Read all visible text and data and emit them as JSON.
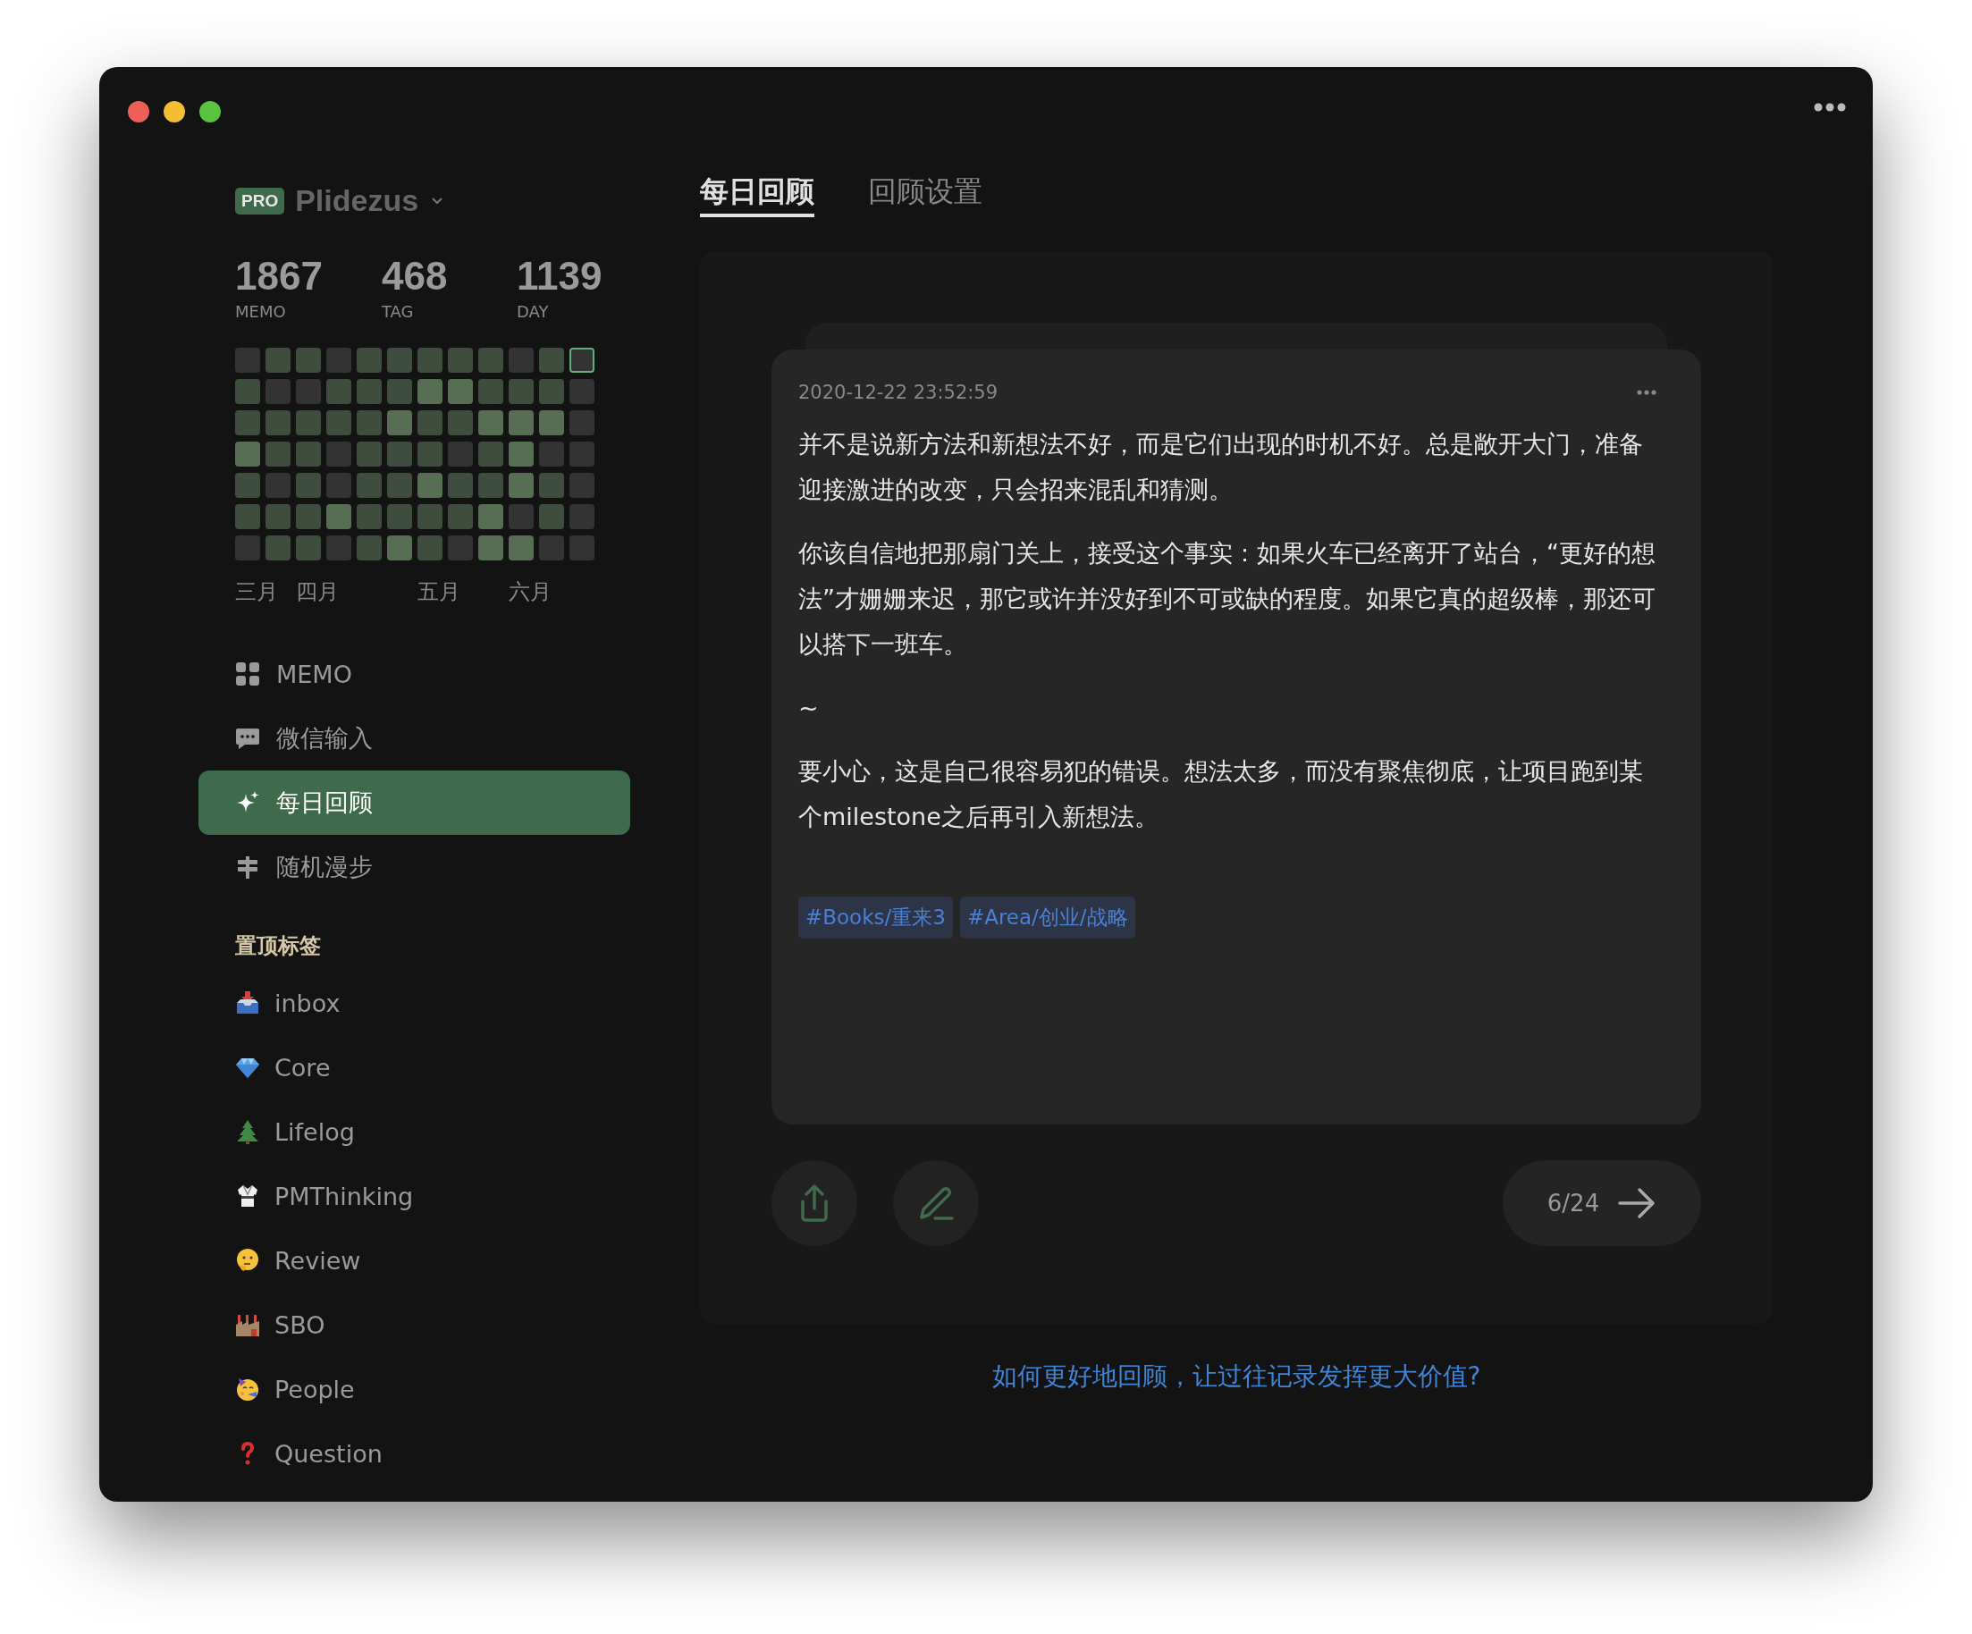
{
  "account": {
    "badge": "PRO",
    "name": "Plidezus"
  },
  "stats": [
    {
      "value": "1867",
      "label": "MEMO"
    },
    {
      "value": "468",
      "label": "TAG"
    },
    {
      "value": "1139",
      "label": "DAY"
    }
  ],
  "heatmap": {
    "rows": [
      {
        "cells": [
          {
            "color": "#333333",
            "selected": false
          },
          {
            "color": "#3f4d3f",
            "selected": false
          },
          {
            "color": "#3f4d3f",
            "selected": false
          },
          {
            "color": "#333333",
            "selected": false
          },
          {
            "color": "#3f4d3f",
            "selected": false
          },
          {
            "color": "#3f4d3f",
            "selected": false
          },
          {
            "color": "#3f4d3f",
            "selected": false
          },
          {
            "color": "#3f4d3f",
            "selected": false
          },
          {
            "color": "#3f4d3f",
            "selected": false
          },
          {
            "color": "#333333",
            "selected": false
          },
          {
            "color": "#3f4d3f",
            "selected": false
          },
          {
            "color": "#333333",
            "selected": true
          }
        ]
      },
      {
        "cells": [
          {
            "color": "#3f4d3f",
            "selected": false
          },
          {
            "color": "#333333",
            "selected": false
          },
          {
            "color": "#333333",
            "selected": false
          },
          {
            "color": "#3f4d3f",
            "selected": false
          },
          {
            "color": "#3f4d3f",
            "selected": false
          },
          {
            "color": "#3f4d3f",
            "selected": false
          },
          {
            "color": "#576e55",
            "selected": false
          },
          {
            "color": "#576e55",
            "selected": false
          },
          {
            "color": "#3f4d3f",
            "selected": false
          },
          {
            "color": "#3f4d3f",
            "selected": false
          },
          {
            "color": "#3f4d3f",
            "selected": false
          },
          {
            "color": "#333333",
            "selected": false
          }
        ]
      },
      {
        "cells": [
          {
            "color": "#3f4d3f",
            "selected": false
          },
          {
            "color": "#3f4d3f",
            "selected": false
          },
          {
            "color": "#3f4d3f",
            "selected": false
          },
          {
            "color": "#3f4d3f",
            "selected": false
          },
          {
            "color": "#3f4d3f",
            "selected": false
          },
          {
            "color": "#576e55",
            "selected": false
          },
          {
            "color": "#3f4d3f",
            "selected": false
          },
          {
            "color": "#3f4d3f",
            "selected": false
          },
          {
            "color": "#576e55",
            "selected": false
          },
          {
            "color": "#576e55",
            "selected": false
          },
          {
            "color": "#576e55",
            "selected": false
          },
          {
            "color": "#333333",
            "selected": false
          }
        ]
      },
      {
        "cells": [
          {
            "color": "#576e55",
            "selected": false
          },
          {
            "color": "#3f4d3f",
            "selected": false
          },
          {
            "color": "#3f4d3f",
            "selected": false
          },
          {
            "color": "#333333",
            "selected": false
          },
          {
            "color": "#3f4d3f",
            "selected": false
          },
          {
            "color": "#3f4d3f",
            "selected": false
          },
          {
            "color": "#3f4d3f",
            "selected": false
          },
          {
            "color": "#333333",
            "selected": false
          },
          {
            "color": "#3f4d3f",
            "selected": false
          },
          {
            "color": "#576e55",
            "selected": false
          },
          {
            "color": "#333333",
            "selected": false
          },
          {
            "color": "#333333",
            "selected": false
          }
        ]
      },
      {
        "cells": [
          {
            "color": "#3f4d3f",
            "selected": false
          },
          {
            "color": "#333333",
            "selected": false
          },
          {
            "color": "#3f4d3f",
            "selected": false
          },
          {
            "color": "#333333",
            "selected": false
          },
          {
            "color": "#3f4d3f",
            "selected": false
          },
          {
            "color": "#3f4d3f",
            "selected": false
          },
          {
            "color": "#576e55",
            "selected": false
          },
          {
            "color": "#3f4d3f",
            "selected": false
          },
          {
            "color": "#3f4d3f",
            "selected": false
          },
          {
            "color": "#576e55",
            "selected": false
          },
          {
            "color": "#3f4d3f",
            "selected": false
          },
          {
            "color": "#333333",
            "selected": false
          }
        ]
      },
      {
        "cells": [
          {
            "color": "#3f4d3f",
            "selected": false
          },
          {
            "color": "#3f4d3f",
            "selected": false
          },
          {
            "color": "#3f4d3f",
            "selected": false
          },
          {
            "color": "#576e55",
            "selected": false
          },
          {
            "color": "#3f4d3f",
            "selected": false
          },
          {
            "color": "#3f4d3f",
            "selected": false
          },
          {
            "color": "#3f4d3f",
            "selected": false
          },
          {
            "color": "#3f4d3f",
            "selected": false
          },
          {
            "color": "#576e55",
            "selected": false
          },
          {
            "color": "#333333",
            "selected": false
          },
          {
            "color": "#3f4d3f",
            "selected": false
          },
          {
            "color": "#333333",
            "selected": false
          }
        ]
      },
      {
        "cells": [
          {
            "color": "#333333",
            "selected": false
          },
          {
            "color": "#3f4d3f",
            "selected": false
          },
          {
            "color": "#3f4d3f",
            "selected": false
          },
          {
            "color": "#333333",
            "selected": false
          },
          {
            "color": "#3f4d3f",
            "selected": false
          },
          {
            "color": "#576e55",
            "selected": false
          },
          {
            "color": "#3f4d3f",
            "selected": false
          },
          {
            "color": "#333333",
            "selected": false
          },
          {
            "color": "#576e55",
            "selected": false
          },
          {
            "color": "#576e55",
            "selected": false
          },
          {
            "color": "#333333",
            "selected": false
          },
          {
            "color": "#333333",
            "selected": false
          }
        ]
      }
    ],
    "months": [
      "三月",
      "四月",
      "五月",
      "六月"
    ]
  },
  "nav": [
    {
      "label": "MEMO",
      "selected": false
    },
    {
      "label": "微信输入",
      "selected": false
    },
    {
      "label": "每日回顾",
      "selected": true
    },
    {
      "label": "随机漫步",
      "selected": false
    }
  ],
  "pinned": {
    "title": "置顶标签",
    "items": [
      {
        "label": "inbox"
      },
      {
        "label": "Core"
      },
      {
        "label": "Lifelog"
      },
      {
        "label": "PMThinking"
      },
      {
        "label": "Review"
      },
      {
        "label": "SBO"
      },
      {
        "label": "People"
      },
      {
        "label": "Question"
      }
    ]
  },
  "tabs": [
    {
      "label": "每日回顾",
      "selected": true
    },
    {
      "label": "回顾设置",
      "selected": false
    }
  ],
  "memo": {
    "timestamp": "2020-12-22 23:52:59",
    "paragraphs": [
      "并不是说新方法和新想法不好，而是它们出现的时机不好。总是敞开大门，准备迎接激进的改变，只会招来混乱和猜测。",
      "你该自信地把那扇门关上，接受这个事实：如果火车已经离开了站台，“更好的想法”才姗姗来迟，那它或许并没好到不可或缺的程度。如果它真的超级棒，那还可以搭下一班车。",
      "~",
      "要小心，这是自己很容易犯的错误。想法太多，而没有聚焦彻底，让项目跑到某个milestone之后再引入新想法。"
    ],
    "tags": [
      "#Books/重来3",
      "#Area/创业/战略"
    ]
  },
  "pager": "6/24",
  "help_link": "如何更好地回顾，让过往记录发挥更大价值?"
}
